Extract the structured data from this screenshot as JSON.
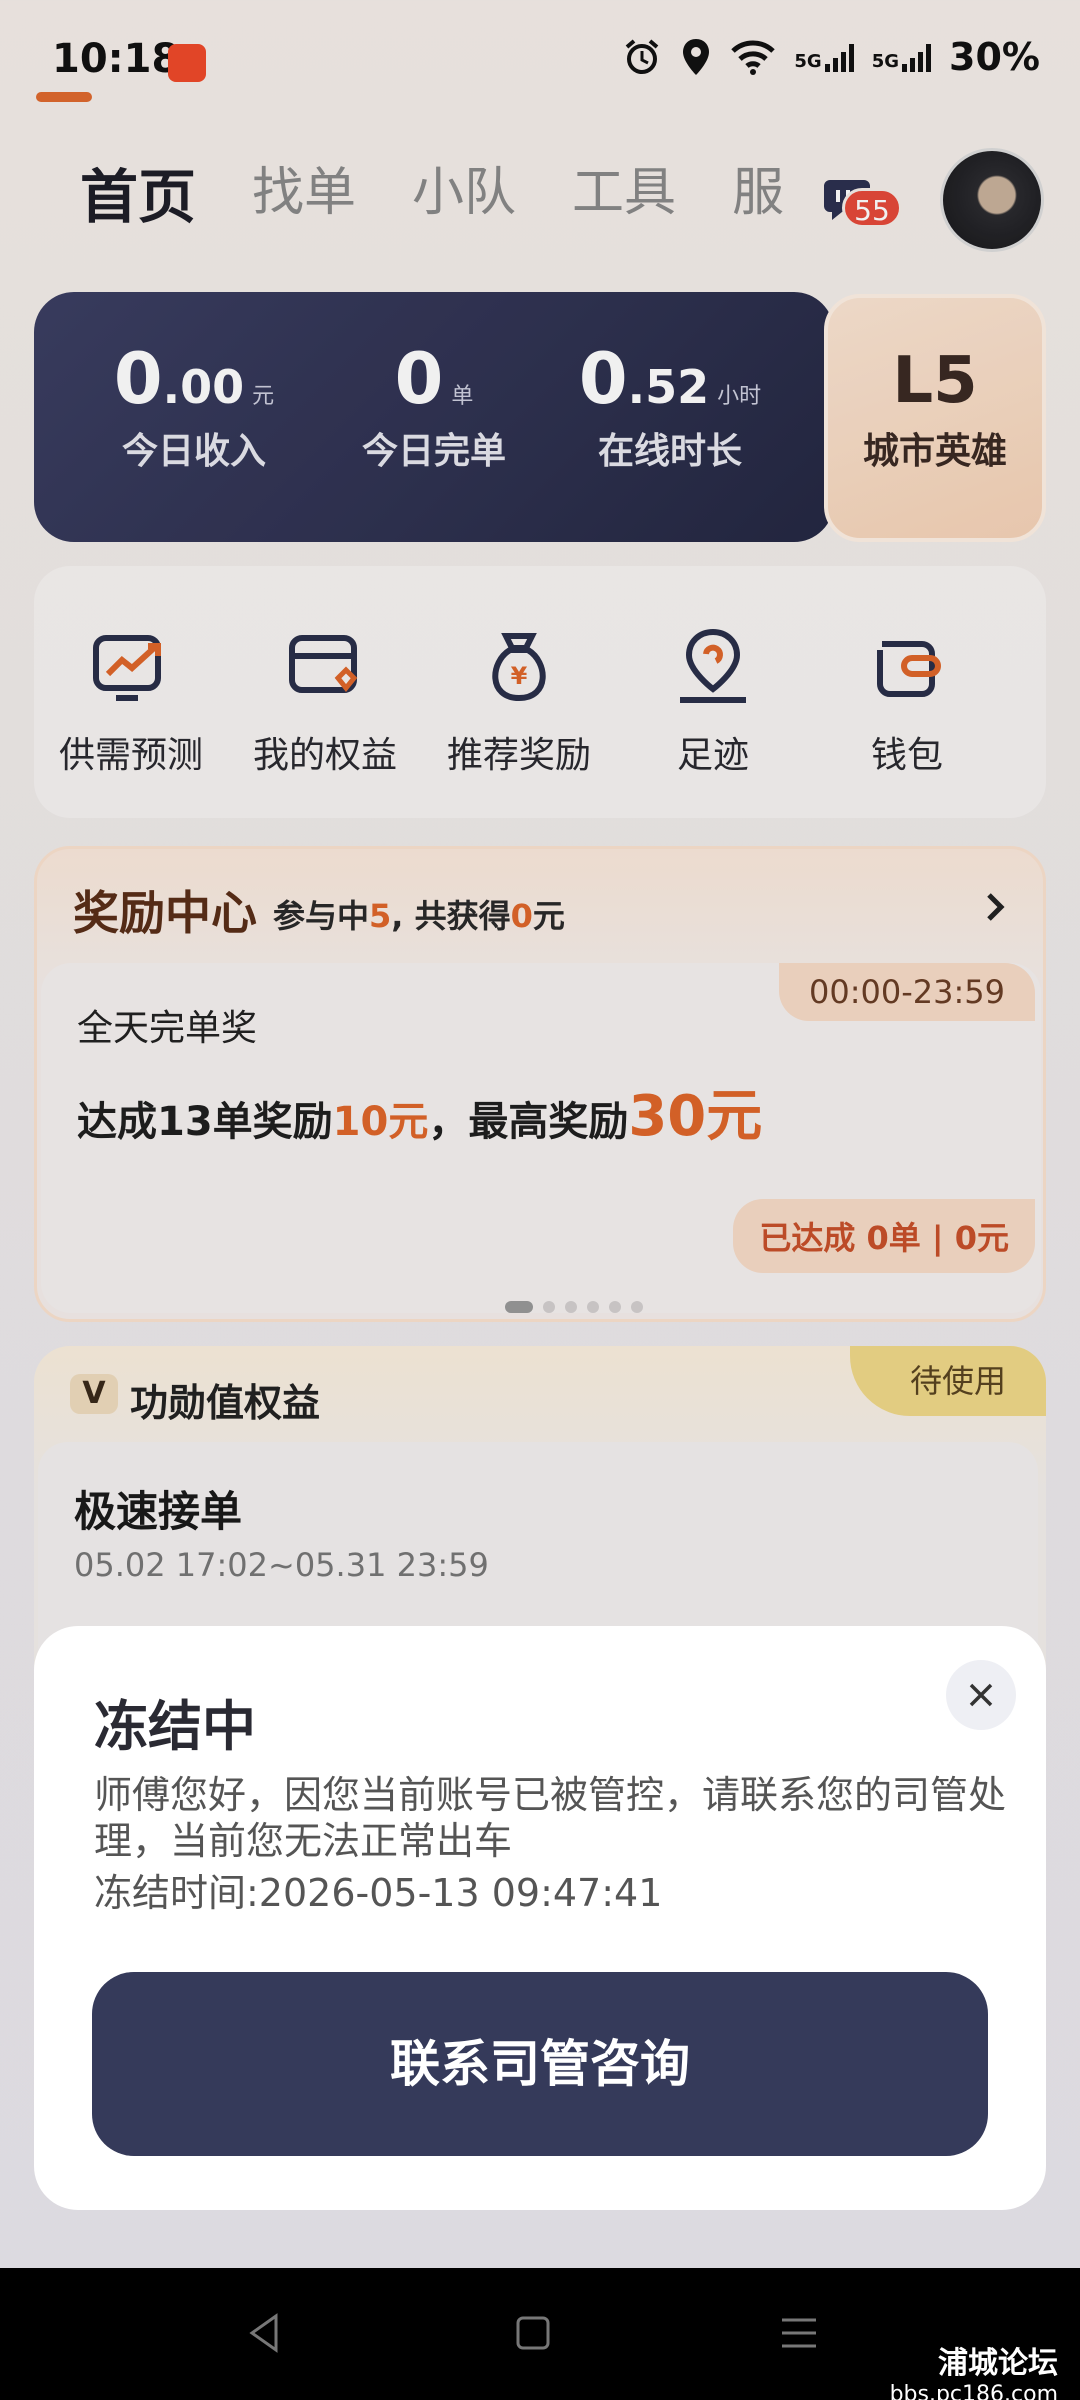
{
  "status_bar": {
    "time": "10:18",
    "app_icon": "app-notification-icon",
    "network_1": "5G",
    "network_2": "5G",
    "battery": "30%"
  },
  "nav": {
    "tabs": [
      "首页",
      "找单",
      "小队",
      "工具",
      "服"
    ],
    "active_tab": 0,
    "message_badge": "55"
  },
  "stats": [
    {
      "integer": "0",
      "fraction": ".00",
      "unit": "元",
      "label": "今日收入"
    },
    {
      "integer": "0",
      "fraction": "",
      "unit": "单",
      "label": "今日完单"
    },
    {
      "integer": "0",
      "fraction": ".52",
      "unit": "小时",
      "label": "在线时长"
    }
  ],
  "level": {
    "code": "L5",
    "name": "城市英雄"
  },
  "tools": [
    {
      "label": "供需预测",
      "icon": "forecast-icon"
    },
    {
      "label": "我的权益",
      "icon": "benefits-icon"
    },
    {
      "label": "推荐奖励",
      "icon": "money-bag-icon"
    },
    {
      "label": "足迹",
      "icon": "location-icon"
    },
    {
      "label": "钱包",
      "icon": "wallet-icon"
    }
  ],
  "reward_center": {
    "title": "奖励中心",
    "summary_prefix": "参与中",
    "summary_count": "5",
    "summary_mid": ", 共获得",
    "summary_amount": "0",
    "summary_suffix": "元",
    "time_range": "00:00-23:59",
    "name": "全天完单奖",
    "desc_prefix": "达成13单奖励",
    "desc_amount": "10元",
    "desc_mid": "，最高奖励",
    "desc_max": "30元",
    "progress": "已达成 0单 | 0元",
    "page_count": 6,
    "active_page": 0
  },
  "merit": {
    "badge": "V",
    "title": "功勋值权益",
    "tag": "待使用",
    "item_name": "极速接单",
    "item_period": "05.02 17:02~05.31 23:59"
  },
  "modal": {
    "title": "冻结中",
    "message": "师傅您好，因您当前账号已被管控，请联系您的司管处理，当前您无法正常出车",
    "freeze_time": "冻结时间:2026-05-13 09:47:41",
    "button": "联系司管咨询"
  },
  "watermark": {
    "name": "浦城论坛",
    "url": "bbs.pc186.com"
  },
  "colors": {
    "accent": "#e0672a",
    "dark_card": "#2b2e4c",
    "button": "#353a5a"
  }
}
